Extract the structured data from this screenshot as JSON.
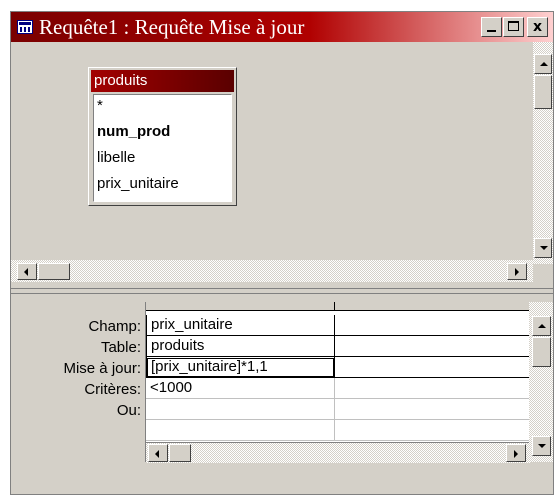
{
  "window": {
    "title": "Requête1 : Requête Mise à jour",
    "controls": {
      "minimize": "_",
      "maximize": "□",
      "close": "x"
    }
  },
  "table_box": {
    "name": "produits",
    "fields": [
      {
        "label": "*",
        "bold": false
      },
      {
        "label": "num_prod",
        "bold": true
      },
      {
        "label": "libelle",
        "bold": false
      },
      {
        "label": "prix_unitaire",
        "bold": false
      }
    ]
  },
  "grid": {
    "row_labels": [
      "Champ:",
      "Table:",
      "Mise à jour:",
      "Critères:",
      "Ou:"
    ],
    "columns": [
      {
        "champ": "prix_unitaire",
        "table": "produits",
        "mise_a_jour": "[prix_unitaire]*1,1",
        "criteres": "<1000",
        "ou": ""
      },
      {
        "champ": "",
        "table": "",
        "mise_a_jour": "",
        "criteres": "",
        "ou": ""
      }
    ]
  }
}
